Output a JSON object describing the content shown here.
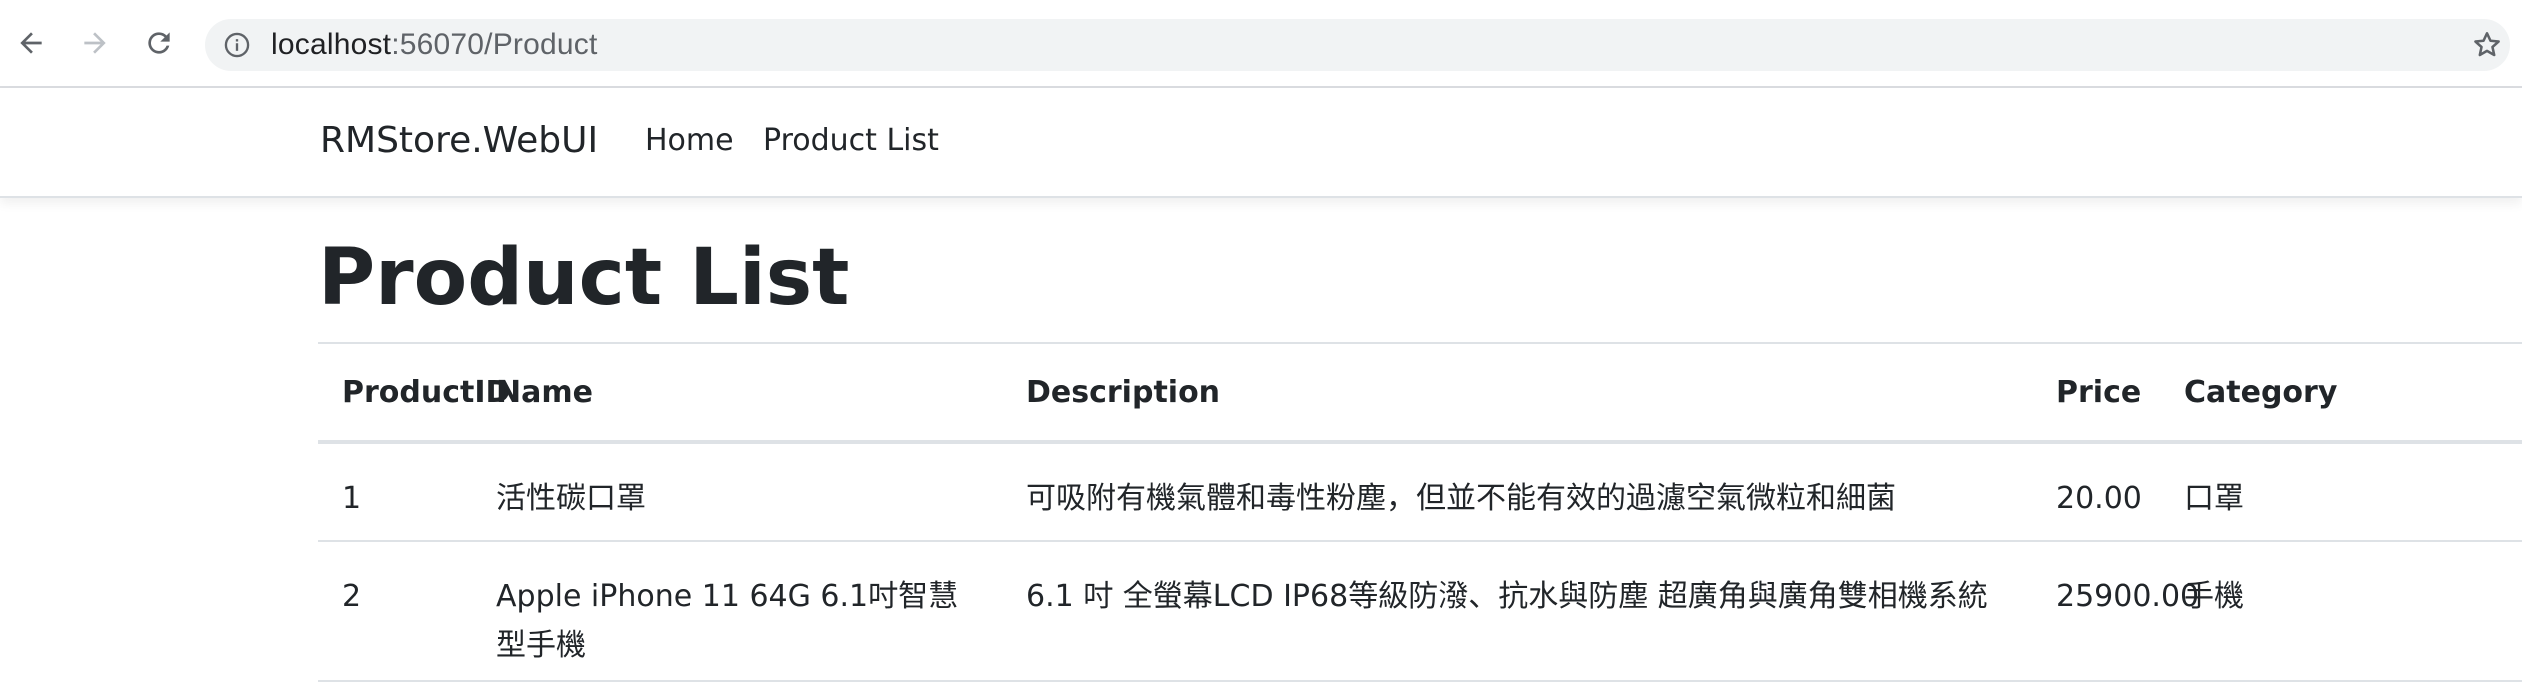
{
  "browser": {
    "url_host": "localhost",
    "url_rest": ":56070/Product",
    "icons": {
      "back": "arrow-left-icon",
      "forward": "arrow-right-icon",
      "reload": "reload-icon",
      "info": "info-icon",
      "bookmark": "star-icon"
    }
  },
  "navbar": {
    "brand": "RMStore.WebUI",
    "links": [
      {
        "label": "Home"
      },
      {
        "label": "Product List"
      }
    ]
  },
  "page": {
    "title": "Product List"
  },
  "table": {
    "columns": [
      "ProductID",
      "Name",
      "Description",
      "Price",
      "Category"
    ],
    "rows": [
      {
        "id": "1",
        "name": "活性碳口罩",
        "description": "可吸附有機氣體和毒性粉塵，但並不能有效的過濾空氣微粒和細菌",
        "price": "20.00",
        "category": "口罩"
      },
      {
        "id": "2",
        "name": "Apple iPhone 11 64G 6.1吋智慧型手機",
        "description": "6.1 吋 全螢幕LCD IP68等級防潑、抗水與防塵 超廣角與廣角雙相機系統",
        "price": "25900.00",
        "category": "手機"
      }
    ]
  },
  "colors": {
    "text": "#212529",
    "border": "#dee2e6",
    "omnibox": "#f1f3f4",
    "url_secondary": "#5f6368"
  }
}
